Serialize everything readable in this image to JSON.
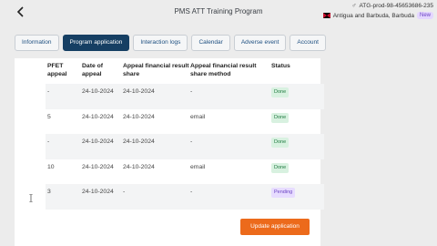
{
  "header": {
    "title": "PMS ATT Training Program",
    "account_id": "ATG-prod-98-45653686-235",
    "country": "Antigua and Barbuda, Barbuda",
    "badge": "New"
  },
  "tabs": [
    {
      "label": "Information",
      "active": false
    },
    {
      "label": "Program application",
      "active": true
    },
    {
      "label": "Interaction logs",
      "active": false
    },
    {
      "label": "Calendar",
      "active": false
    },
    {
      "label": "Adverse event",
      "active": false
    },
    {
      "label": "Account",
      "active": false
    }
  ],
  "table": {
    "headers": {
      "pfet_appeal": "PFET appeal",
      "date_of_appeal": "Date of appeal",
      "result_share": "Appeal financial result share",
      "share_method": "Appeal financial result share method",
      "status": "Status"
    },
    "rows": [
      {
        "pfet": "-",
        "date": "24-10-2024",
        "share": "24-10-2024",
        "method": "-",
        "status": "Done"
      },
      {
        "pfet": "5",
        "date": "24-10-2024",
        "share": "24-10-2024",
        "method": "email",
        "status": "Done"
      },
      {
        "pfet": "-",
        "date": "24-10-2024",
        "share": "24-10-2024",
        "method": "-",
        "status": "Done"
      },
      {
        "pfet": "10",
        "date": "24-10-2024",
        "share": "24-10-2024",
        "method": "email",
        "status": "Done"
      },
      {
        "pfet": "3",
        "date": "24-10-2024",
        "share": "-",
        "method": "-",
        "status": "Pending"
      }
    ]
  },
  "actions": {
    "update_label": "Update application"
  },
  "colors": {
    "accent": "#163f63",
    "action": "#ec6a1b",
    "done_bg": "#d8f1e0",
    "pending_bg": "#e7dcff"
  }
}
